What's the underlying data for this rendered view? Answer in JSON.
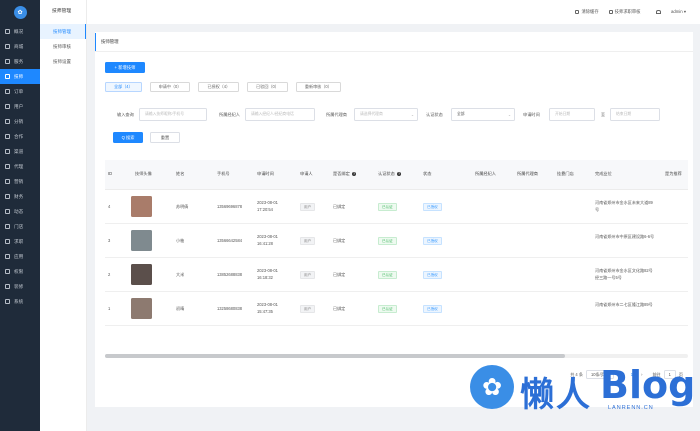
{
  "sidebar": {
    "logo": "✿",
    "items": [
      {
        "label": "概况",
        "active": false
      },
      {
        "label": "商城",
        "active": false
      },
      {
        "label": "服务",
        "active": false
      },
      {
        "label": "技师",
        "active": true
      },
      {
        "label": "订单",
        "active": false
      },
      {
        "label": "用户",
        "active": false
      },
      {
        "label": "分销",
        "active": false
      },
      {
        "label": "合作",
        "active": false
      },
      {
        "label": "渠道",
        "active": false
      },
      {
        "label": "代理",
        "active": false
      },
      {
        "label": "营销",
        "active": false
      },
      {
        "label": "财务",
        "active": false
      },
      {
        "label": "动态",
        "active": false
      },
      {
        "label": "门店",
        "active": false
      },
      {
        "label": "求职",
        "active": false
      },
      {
        "label": "应用",
        "active": false
      },
      {
        "label": "权限",
        "active": false
      },
      {
        "label": "装修",
        "active": false
      },
      {
        "label": "系统",
        "active": false
      }
    ]
  },
  "subsidebar": {
    "title": "技师管理",
    "items": [
      {
        "label": "技师管理",
        "active": true
      },
      {
        "label": "技师审核",
        "active": false
      },
      {
        "label": "技师设置",
        "active": false
      }
    ]
  },
  "topbar": {
    "clear_cache": "清除缓存",
    "pending_audit": "技师求职审核",
    "user": "admin ▾"
  },
  "page": {
    "breadcrumb": "技师管理",
    "add_button": "+ 新增技师",
    "tabs": [
      "全部（4）",
      "申请中（0）",
      "已授权（4）",
      "已驳回（0）",
      "重新审核（0）"
    ]
  },
  "filters": {
    "keyword_label": "输入查询",
    "keyword_placeholder": "请输入技师昵称/手机号",
    "mediator_label": "所属经纪人",
    "mediator_placeholder": "请输入经纪人/经纪商电话",
    "agent_label": "所属代理商",
    "agent_placeholder": "请选择代理商",
    "status_label": "认证状态",
    "status_value": "全部",
    "time_label": "申请时间",
    "date_start": "开始日期",
    "date_sep": "至",
    "date_end": "结束日期",
    "search_button": "Q 搜索",
    "reset_button": "重置"
  },
  "table": {
    "headers": [
      "ID",
      "技师头像",
      "姓名",
      "手机号",
      "申请时间",
      "申请人",
      "是否绑定",
      "认证状态",
      "状态",
      "所属经纪人",
      "所属代理商",
      "挂靠门店",
      "完成业位",
      "是为推荐"
    ],
    "rows": [
      {
        "id": "4",
        "name": "苏明倩",
        "phone": "13569696878",
        "time": "2023-08-01 17:20:54",
        "applicant": "用户",
        "bound": "已绑定",
        "cert": "已认证",
        "status": "已授权",
        "address": "河南省郑州市金水区未来大道89号"
      },
      {
        "id": "3",
        "name": "小柚",
        "phone": "13566642584",
        "time": "2023-08-01 16:41:28",
        "applicant": "用户",
        "bound": "已绑定",
        "cert": "已认证",
        "status": "已授权",
        "address": "河南省郑州市中原区建设路6-6号"
      },
      {
        "id": "2",
        "name": "大米",
        "phone": "13852688838",
        "time": "2023-08-01 16:18:32",
        "applicant": "用户",
        "bound": "已绑定",
        "cert": "已认证",
        "status": "已授权",
        "address": "河南省郑州市金水区文化路82号经三路一号5号"
      },
      {
        "id": "1",
        "name": "初晴",
        "phone": "13258680838",
        "time": "2023-08-01 15:47:35",
        "applicant": "用户",
        "bound": "已绑定",
        "cert": "已认证",
        "status": "已授权",
        "address": "河南省郑州市二七区隆江路89号"
      }
    ]
  },
  "pager": {
    "total": "共 4 条",
    "per_page": "10条/页",
    "prev": "‹",
    "page": "1",
    "next": "›",
    "goto": "前往",
    "goto_value": "1",
    "page_suffix": "页"
  },
  "watermark": {
    "mark": "✿",
    "cn": "懒人",
    "en": "Blog",
    "url": "LANRENN.CN"
  },
  "colors": {
    "accent": "#1e88ff",
    "sidebar_bg": "#1f2b3a",
    "success": "#45b864"
  }
}
